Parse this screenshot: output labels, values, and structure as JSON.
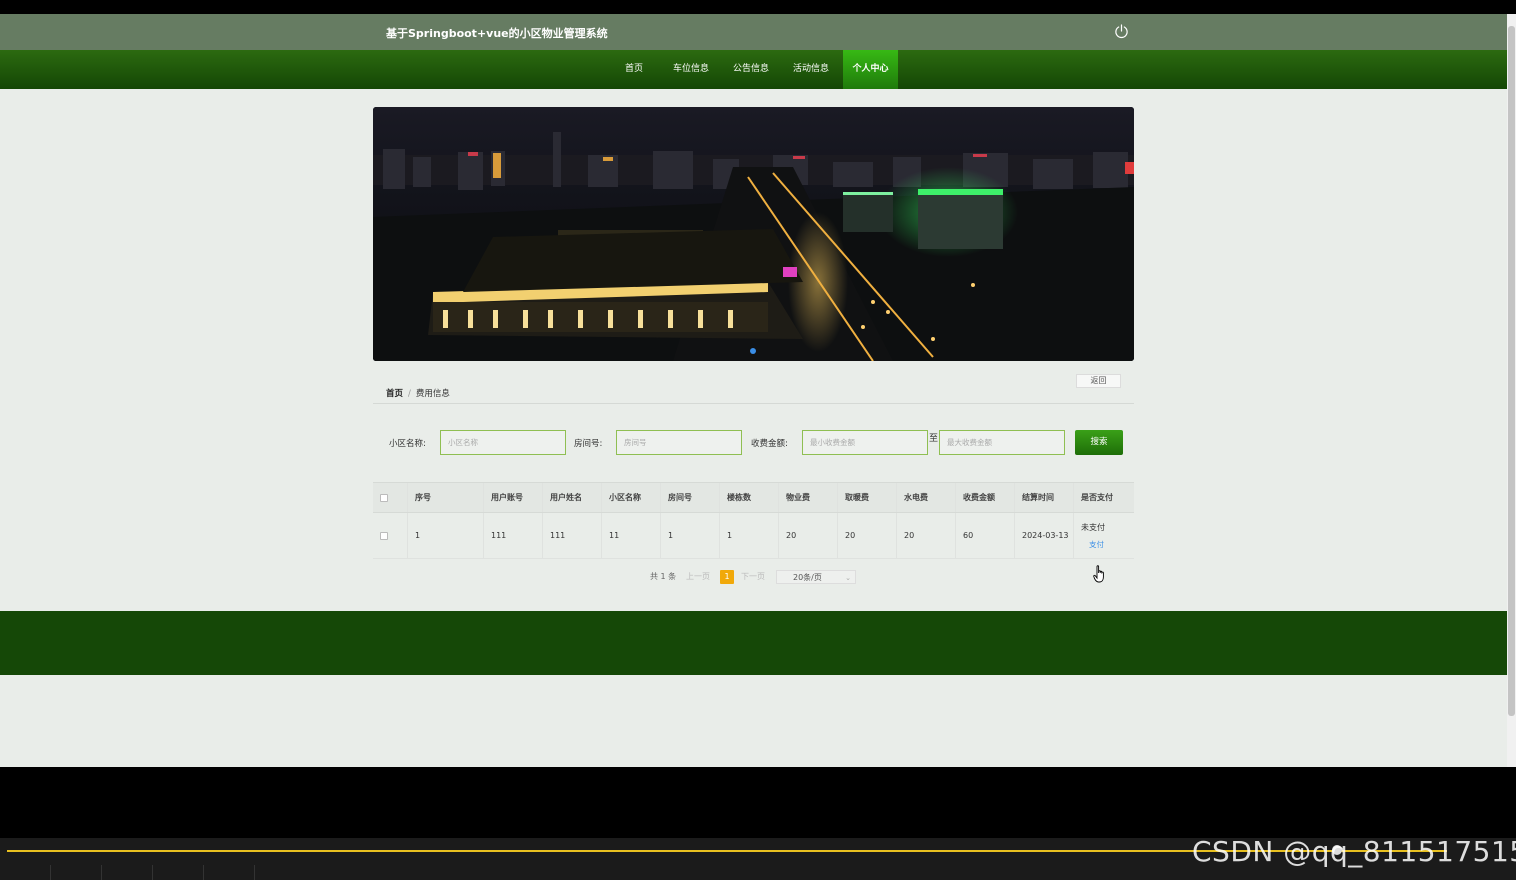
{
  "header": {
    "title": "基于Springboot+vue的小区物业管理系统"
  },
  "nav": [
    {
      "label": "首页",
      "active": false
    },
    {
      "label": "车位信息",
      "active": false
    },
    {
      "label": "公告信息",
      "active": false
    },
    {
      "label": "活动信息",
      "active": false
    },
    {
      "label": "个人中心",
      "active": true
    }
  ],
  "back_label": "返回",
  "breadcrumb": {
    "home": "首页",
    "sep": "/",
    "current": "费用信息"
  },
  "filters": {
    "community_label": "小区名称:",
    "community_placeholder": "小区名称",
    "room_label": "房间号:",
    "room_placeholder": "房间号",
    "amount_label": "收费金额:",
    "amount_min_placeholder": "最小收费金额",
    "to_label": "至",
    "amount_max_placeholder": "最大收费金额",
    "search_label": "搜索"
  },
  "table": {
    "columns": [
      "序号",
      "用户账号",
      "用户姓名",
      "小区名称",
      "房间号",
      "楼栋数",
      "物业费",
      "取暖费",
      "水电费",
      "收费金额",
      "结算时间",
      "是否支付"
    ],
    "rows": [
      {
        "cells": [
          "1",
          "111",
          "111",
          "11",
          "1",
          "1",
          "20",
          "20",
          "20",
          "60",
          "2024-03-13"
        ],
        "status": "未支付",
        "action": "支付"
      }
    ]
  },
  "pagination": {
    "total": "共 1 条",
    "prev": "上一页",
    "current": "1",
    "next": "下一页",
    "page_size": "20条/页"
  },
  "watermark": "CSDN @qq_811517515",
  "colors": {
    "header_bar": "#667c62",
    "nav_green": "#1d5a0a",
    "nav_active": "#2ea00f",
    "footer": "#154807",
    "page_highlight": "#f1a90a"
  }
}
